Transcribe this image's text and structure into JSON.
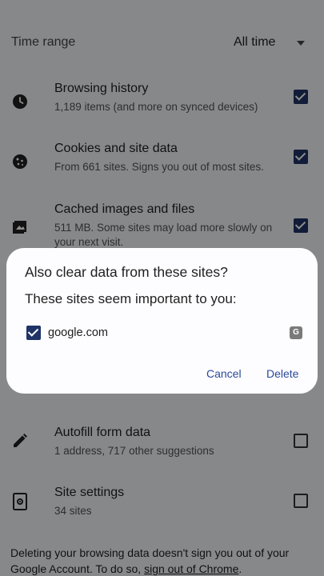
{
  "time_range": {
    "label": "Time range",
    "value": "All time"
  },
  "rows": [
    {
      "title": "Browsing history",
      "sub": "1,189 items (and more on synced devices)",
      "checked": true,
      "icon": "clock-icon"
    },
    {
      "title": "Cookies and site data",
      "sub": "From 661 sites. Signs you out of most sites.",
      "checked": true,
      "icon": "cookie-icon"
    },
    {
      "title": "Cached images and files",
      "sub": "511 MB. Some sites may load more slowly on your next visit.",
      "checked": true,
      "icon": "image-icon"
    },
    {
      "title": "Autofill form data",
      "sub": "1 address, 717 other suggestions",
      "checked": false,
      "icon": "pencil-icon"
    },
    {
      "title": "Site settings",
      "sub": "34 sites",
      "checked": false,
      "icon": "site-settings-icon"
    }
  ],
  "dialog": {
    "title": "Also clear data from these sites?",
    "subtitle": "These sites seem important to you:",
    "site": "google.com",
    "favicon_letter": "G",
    "cancel": "Cancel",
    "delete": "Delete"
  },
  "footer": {
    "text": "Deleting your browsing data doesn't sign you out of your Google Account. To do so, ",
    "link": "sign out of Chrome",
    "end": "."
  },
  "colors": {
    "accent": "#1f3366",
    "link_button": "#2b4a9a"
  }
}
